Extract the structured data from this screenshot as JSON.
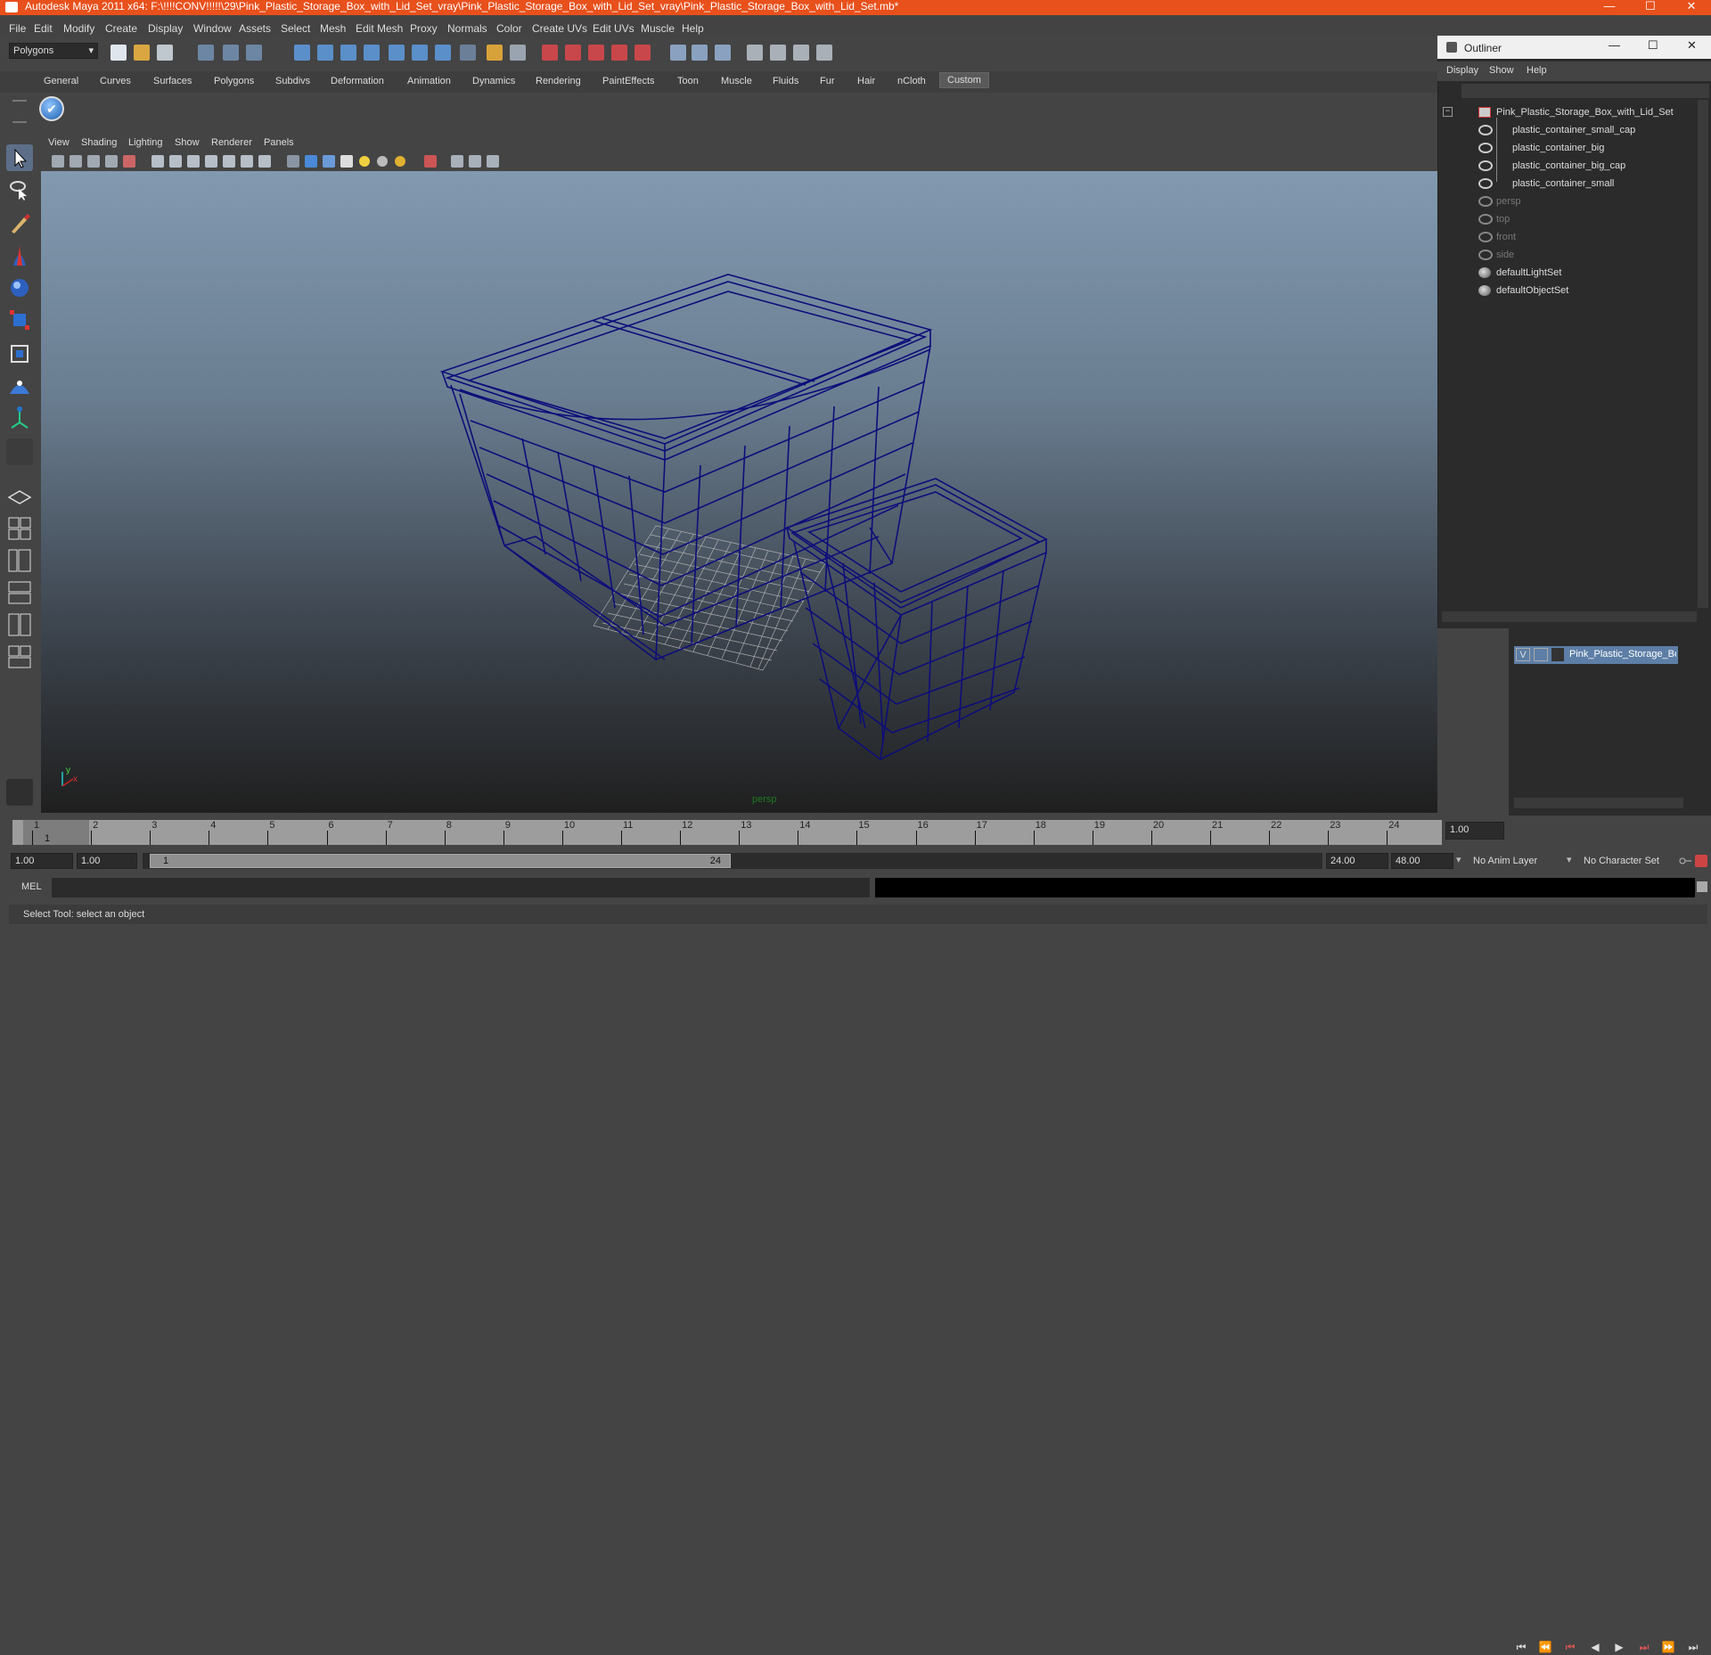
{
  "window": {
    "title": "Autodesk Maya 2011 x64: F:\\!!!!CONV!!!!!\\29\\Pink_Plastic_Storage_Box_with_Lid_Set_vray\\Pink_Plastic_Storage_Box_with_Lid_Set_vray\\Pink_Plastic_Storage_Box_with_Lid_Set.mb*",
    "minimize": "—",
    "maximize": "☐",
    "close": "✕"
  },
  "menubar": [
    "File",
    "Edit",
    "Modify",
    "Create",
    "Display",
    "Window",
    "Assets",
    "Select",
    "Mesh",
    "Edit Mesh",
    "Proxy",
    "Normals",
    "Color",
    "Create UVs",
    "Edit UVs",
    "Muscle",
    "Help"
  ],
  "statusline": {
    "mode": "Polygons"
  },
  "shelf_tabs": [
    "General",
    "Curves",
    "Surfaces",
    "Polygons",
    "Subdivs",
    "Deformation",
    "Animation",
    "Dynamics",
    "Rendering",
    "PaintEffects",
    "Toon",
    "Muscle",
    "Fluids",
    "Fur",
    "Hair",
    "nCloth",
    "Custom"
  ],
  "shelf_active": "Custom",
  "panel_menu": [
    "View",
    "Shading",
    "Lighting",
    "Show",
    "Renderer",
    "Panels"
  ],
  "viewport": {
    "camera_label": "persp",
    "axis_y": "y",
    "axis_x": "x"
  },
  "timeline": {
    "ticks": [
      "1",
      "2",
      "3",
      "4",
      "5",
      "6",
      "7",
      "8",
      "9",
      "10",
      "11",
      "12",
      "13",
      "14",
      "15",
      "16",
      "17",
      "18",
      "19",
      "20",
      "21",
      "22",
      "23",
      "24"
    ],
    "current_frame_field": "1.00",
    "current_marker": "1"
  },
  "range": {
    "start": "1.00",
    "playback_start": "1.00",
    "slider_start": "1",
    "slider_end": "24",
    "playback_end": "24.00",
    "end": "48.00",
    "anim_layer": "No Anim Layer",
    "character_set": "No Character Set"
  },
  "cmdline": {
    "label": "MEL"
  },
  "helpline": {
    "text": "Select Tool: select an object"
  },
  "outliner": {
    "title": "Outliner",
    "menu": [
      "Display",
      "Show",
      "Help"
    ],
    "items": [
      {
        "label": "Pink_Plastic_Storage_Box_with_Lid_Set",
        "level": 0,
        "dim": false
      },
      {
        "label": "plastic_container_small_cap",
        "level": 1,
        "dim": false
      },
      {
        "label": "plastic_container_big",
        "level": 1,
        "dim": false
      },
      {
        "label": "plastic_container_big_cap",
        "level": 1,
        "dim": false
      },
      {
        "label": "plastic_container_small",
        "level": 1,
        "dim": false
      },
      {
        "label": "persp",
        "level": 0,
        "dim": true
      },
      {
        "label": "top",
        "level": 0,
        "dim": true
      },
      {
        "label": "front",
        "level": 0,
        "dim": true
      },
      {
        "label": "side",
        "level": 0,
        "dim": true
      },
      {
        "label": "defaultLightSet",
        "level": 0,
        "dim": false
      },
      {
        "label": "defaultObjectSet",
        "level": 0,
        "dim": false
      }
    ]
  },
  "layer": {
    "visibility": "V",
    "name": "Pink_Plastic_Storage_Box"
  },
  "colors": {
    "title_bar": "#e8501c",
    "wireframe": "#0d0d7a",
    "layer_highlight": "#5d7ea6"
  }
}
